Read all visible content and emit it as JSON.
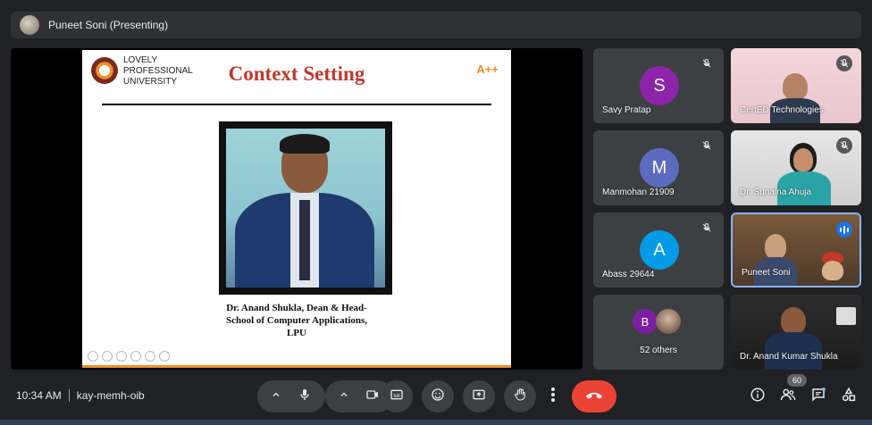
{
  "presenter": {
    "label": "Puneet Soni (Presenting)"
  },
  "slide": {
    "logo_lines": [
      "LOVELY",
      "PROFESSIONAL",
      "UNIVERSITY"
    ],
    "title": "Context Setting",
    "badge": "A++",
    "caption_lines": [
      "Dr. Anand Shukla, Dean & Head-",
      "School of Computer Applications,",
      "LPU"
    ]
  },
  "participants": [
    {
      "name": "Savy Pratap",
      "initial": "S",
      "avatar_color": "#8e24aa",
      "muted": true
    },
    {
      "name": "CertED Technologies",
      "muted": true
    },
    {
      "name": "Manmohan 21909",
      "initial": "M",
      "avatar_color": "#5c6bc0",
      "muted": true
    },
    {
      "name": "Dr. Sunaina Ahuja",
      "muted": true
    },
    {
      "name": "Abass 29644",
      "initial": "A",
      "avatar_color": "#039be5",
      "muted": true
    },
    {
      "name": "Puneet Soni",
      "speaking": true
    },
    {
      "name": "52 others",
      "initial": "B",
      "avatar_color": "#7b1fa2"
    },
    {
      "name": "Dr. Anand Kumar Shukla"
    }
  ],
  "meeting": {
    "time": "10:34 AM",
    "code": "kay-memh-oib",
    "participant_count": "60"
  },
  "colors": {
    "accent": "#8ab4f8",
    "end_call": "#ea4335",
    "bar": "#3c4043"
  }
}
